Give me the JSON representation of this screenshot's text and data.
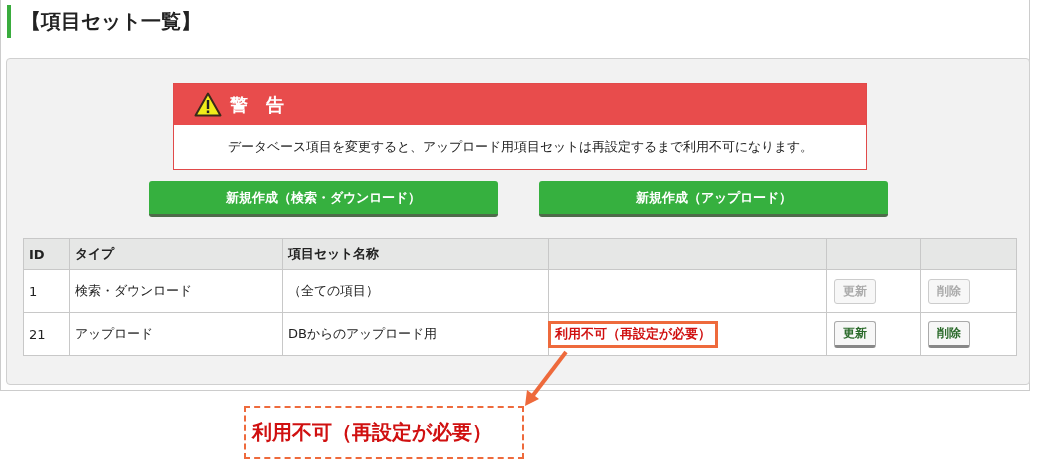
{
  "title": "【項目セット一覧】",
  "warning": {
    "heading": "警　告",
    "message": "データベース項目を変更すると、アップロード用項目セットは再設定するまで利用不可になります。"
  },
  "buttons": [
    "新規作成（検索・ダウンロード）",
    "新規作成（アップロード）"
  ],
  "table": {
    "columns": [
      "ID",
      "タイプ",
      "項目セット名称"
    ],
    "rows": [
      {
        "id": "1",
        "type": "検索・ダウンロード",
        "name": "（全ての項目）",
        "update": {
          "label": "更新",
          "disabled": true
        },
        "delete": {
          "label": "削除",
          "disabled": true
        }
      },
      {
        "id": "21",
        "type": "アップロード",
        "name": "DBからのアップロード用",
        "status": "利用不可（再設定が必要）",
        "highlighted": true,
        "update": {
          "label": "更新",
          "disabled": false
        },
        "delete": {
          "label": "削除",
          "disabled": false
        }
      }
    ]
  },
  "callout": {
    "text": "利用不可（再設定が必要）"
  }
}
